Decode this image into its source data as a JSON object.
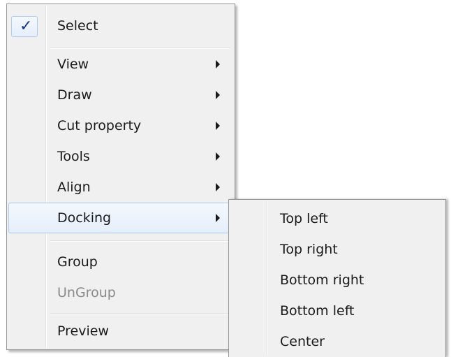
{
  "context_menu": {
    "select": {
      "label": "Select",
      "checked": true,
      "check_glyph": "✓"
    },
    "items": [
      {
        "label": "View",
        "has_submenu": true
      },
      {
        "label": "Draw",
        "has_submenu": true
      },
      {
        "label": "Cut property",
        "has_submenu": true
      },
      {
        "label": "Tools",
        "has_submenu": true
      },
      {
        "label": "Align",
        "has_submenu": true
      },
      {
        "label": "Docking",
        "has_submenu": true,
        "highlighted": true
      }
    ],
    "group": {
      "label": "Group",
      "enabled": true
    },
    "ungroup": {
      "label": "UnGroup",
      "enabled": false
    },
    "preview": {
      "label": "Preview"
    }
  },
  "docking_submenu": {
    "items": [
      {
        "label": "Top left"
      },
      {
        "label": "Top right"
      },
      {
        "label": "Bottom right"
      },
      {
        "label": "Bottom left"
      },
      {
        "label": "Center"
      }
    ]
  },
  "colors": {
    "menu_bg": "#f0f0f0",
    "menu_border": "#979797",
    "highlight_border": "#a8caf0",
    "check_color": "#1a3b8a",
    "disabled_text": "#8a8a8a"
  },
  "icons": {
    "check": "check-icon",
    "submenu": "chevron-right-icon"
  }
}
